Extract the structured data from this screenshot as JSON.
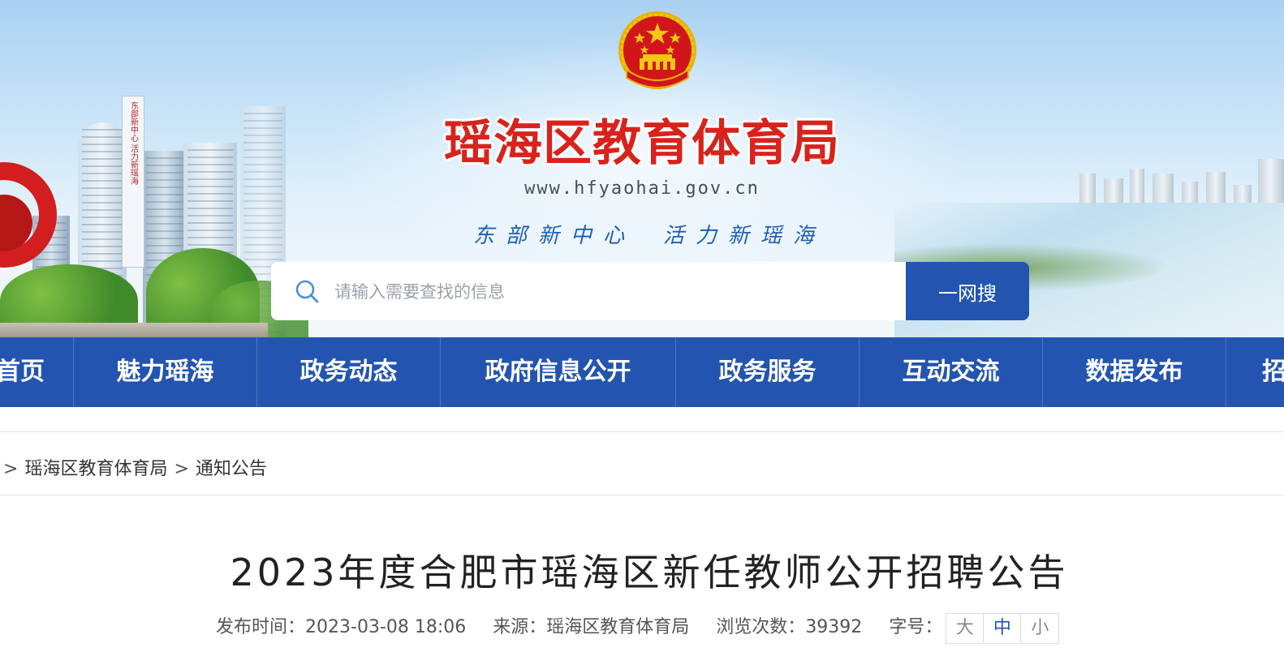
{
  "site": {
    "title": "瑶海区教育体育局",
    "url": "www.hfyaohai.gov.cn",
    "slogan_left": "东部新中心",
    "slogan_right": "活力新瑶海",
    "tower_sign_text": "东部新中心 活力新瑶海"
  },
  "search": {
    "placeholder": "请输入需要查找的信息",
    "button_label": "一网搜"
  },
  "nav": {
    "items": [
      {
        "label": "首页"
      },
      {
        "label": "魅力瑶海"
      },
      {
        "label": "政务动态"
      },
      {
        "label": "政府信息公开"
      },
      {
        "label": "政务服务"
      },
      {
        "label": "互动交流"
      },
      {
        "label": "数据发布"
      },
      {
        "label": "招"
      }
    ]
  },
  "breadcrumb": {
    "separator": ">",
    "items": [
      "瑶海区教育体育局",
      "通知公告"
    ]
  },
  "article": {
    "title": "2023年度合肥市瑶海区新任教师公开招聘公告",
    "publish_label": "发布时间：",
    "publish_time": "2023-03-08 18:06",
    "source_label": "来源：",
    "source": "瑶海区教育体育局",
    "views_label": "浏览次数：",
    "views": "39392",
    "fontsize_label": "字号：",
    "fontsize_options": [
      "大",
      "中",
      "小"
    ],
    "fontsize_selected": "中"
  },
  "colors": {
    "nav_bg": "#2355b0",
    "title_red": "#d8231c",
    "slogan_blue": "#1d5fb4"
  }
}
